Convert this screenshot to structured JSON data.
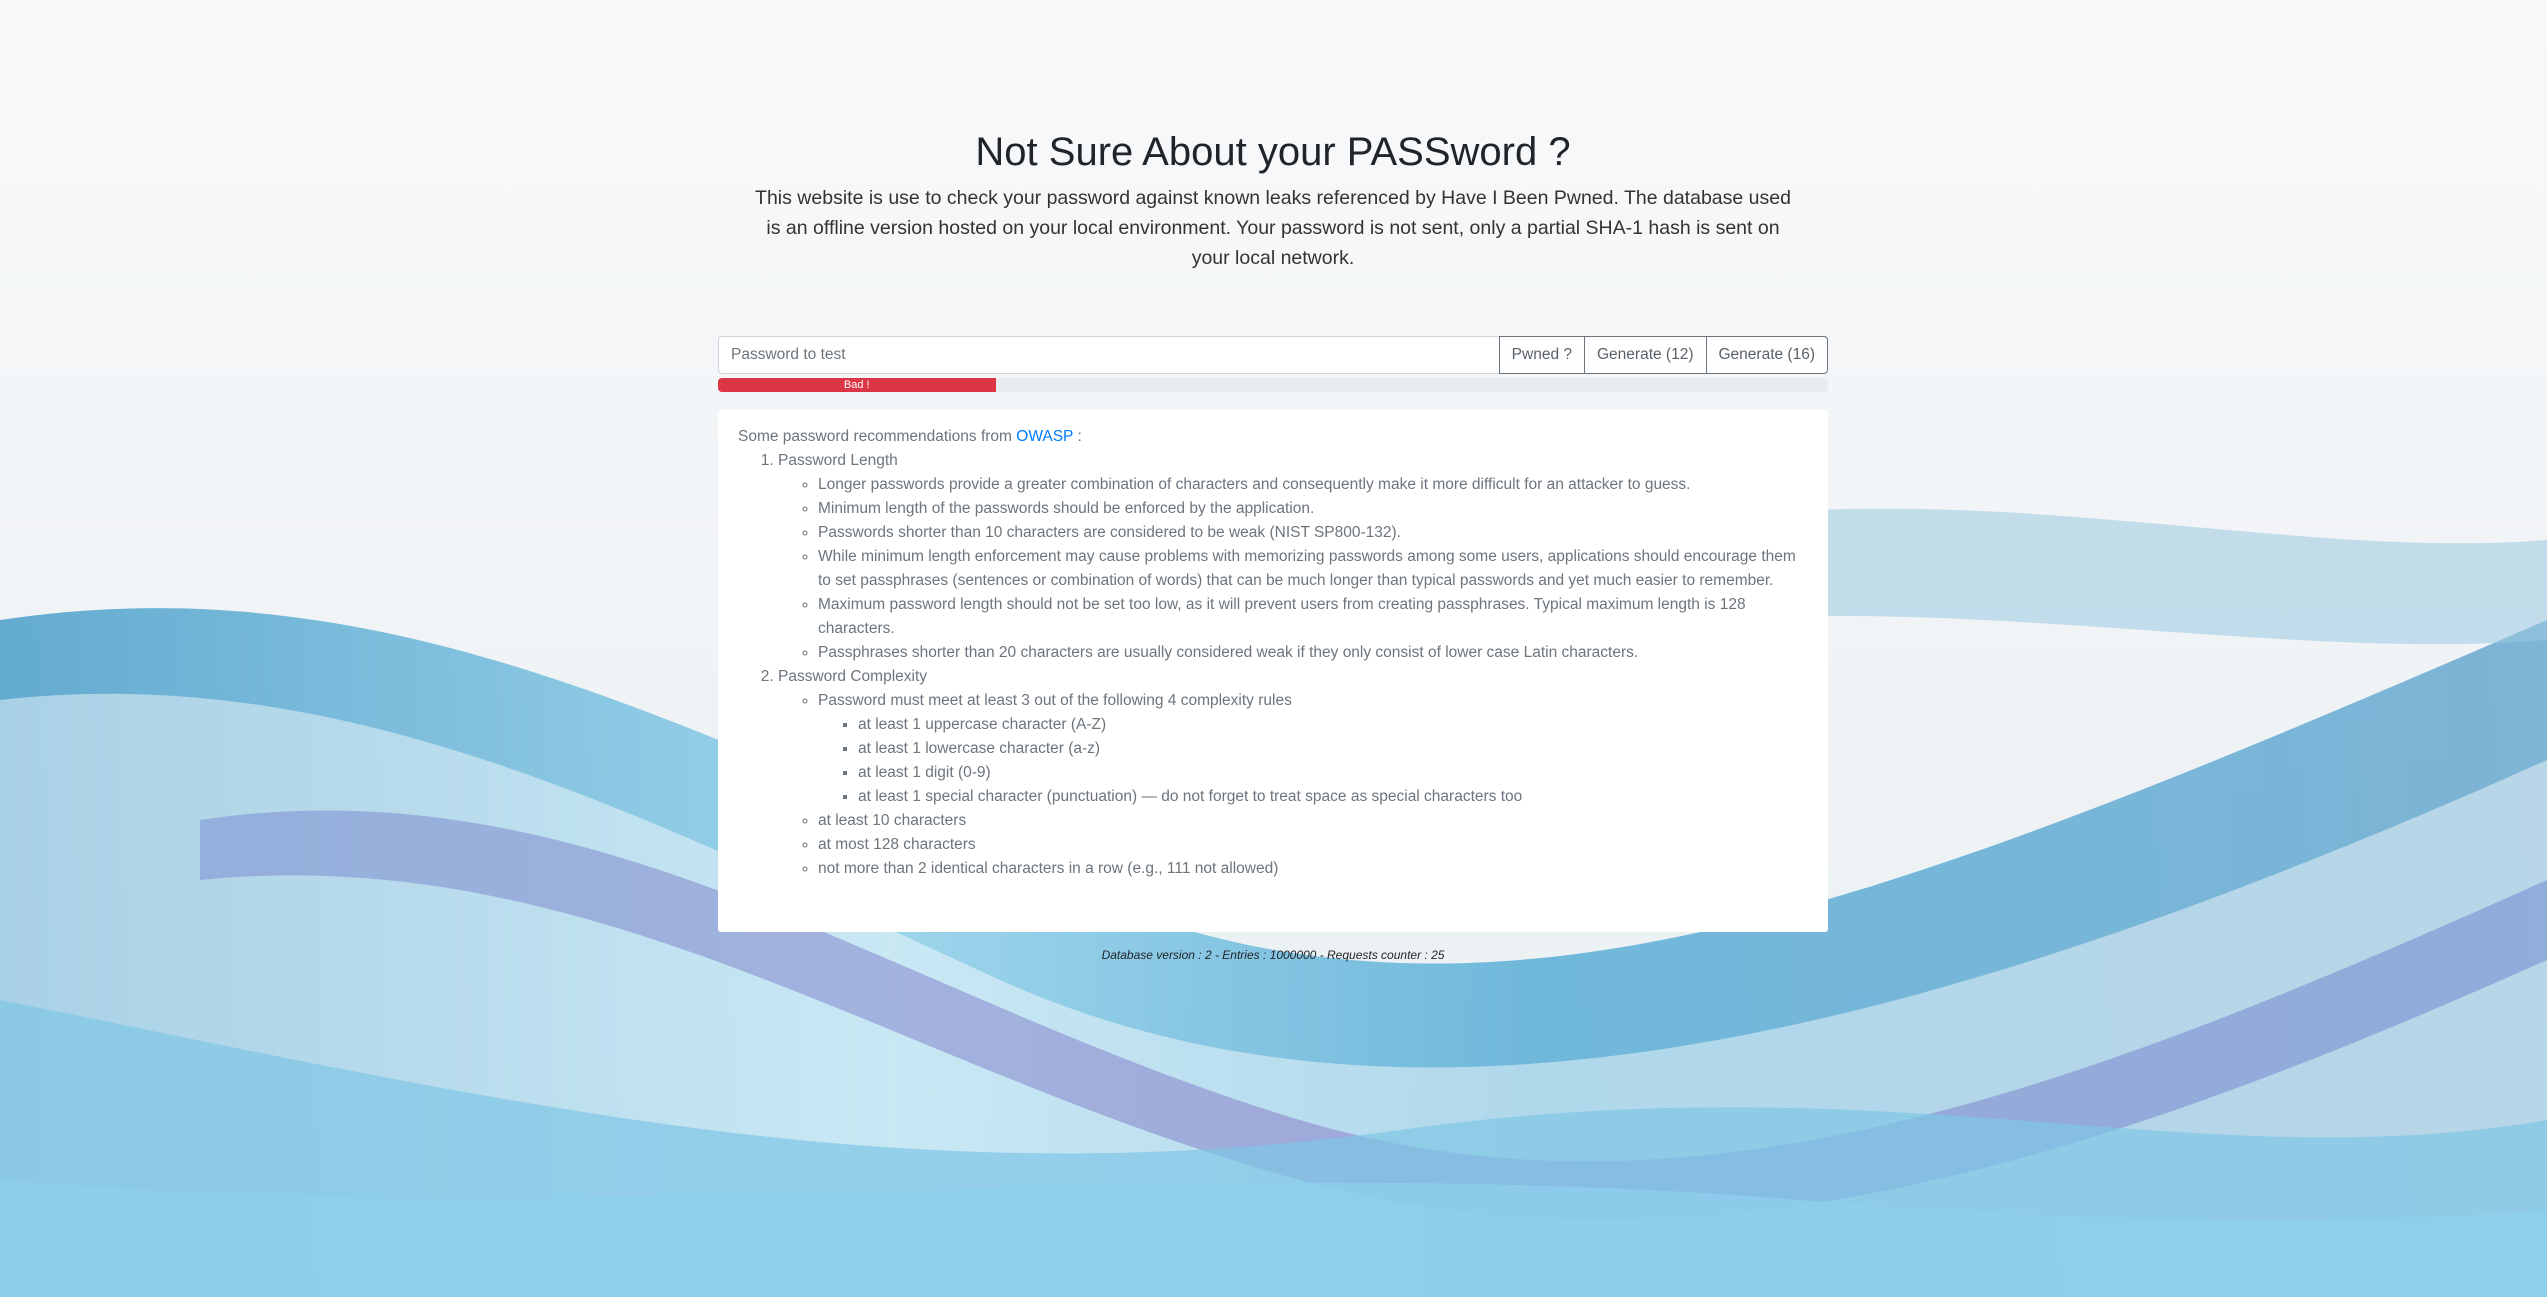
{
  "page": {
    "title": "Not Sure About your PASSword ?",
    "lead": "This website is use to check your password against known leaks referenced by Have I Been Pwned. The database used is an offline version hosted on your local environment. Your password is not sent, only a partial SHA-1 hash is sent on your local network."
  },
  "form": {
    "placeholder": "Password to test",
    "value": "",
    "pwned_label": "Pwned ?",
    "generate12_label": "Generate (12)",
    "generate16_label": "Generate (16)"
  },
  "strength": {
    "label": "Bad !",
    "percent": 25,
    "color": "#dc3545"
  },
  "recommendations": {
    "intro_prefix": "Some password recommendations from",
    "link_text": "OWASP",
    "intro_suffix": ":",
    "sections": [
      {
        "title": "Password Length",
        "items": [
          {
            "text": "Longer passwords provide a greater combination of characters and consequently make it more difficult for an attacker to guess."
          },
          {
            "text": "Minimum length of the passwords should be enforced by the application."
          },
          {
            "text": "Passwords shorter than 10 characters are considered to be weak (NIST SP800-132)."
          },
          {
            "text": "While minimum length enforcement may cause problems with memorizing passwords among some users, applications should encourage them to set passphrases (sentences or combination of words) that can be much longer than typical passwords and yet much easier to remember."
          },
          {
            "text": "Maximum password length should not be set too low, as it will prevent users from creating passphrases. Typical maximum length is 128 characters."
          },
          {
            "text": "Passphrases shorter than 20 characters are usually considered weak if they only consist of lower case Latin characters."
          }
        ]
      },
      {
        "title": "Password Complexity",
        "items": [
          {
            "text": "Password must meet at least 3 out of the following 4 complexity rules",
            "sub": [
              "at least 1 uppercase character (A-Z)",
              "at least 1 lowercase character (a-z)",
              "at least 1 digit (0-9)",
              "at least 1 special character (punctuation) — do not forget to treat space as special characters too"
            ]
          },
          {
            "text": "at least 10 characters"
          },
          {
            "text": "at most 128 characters"
          },
          {
            "text": "not more than 2 identical characters in a row (e.g., 111 not allowed)"
          }
        ]
      }
    ]
  },
  "footer": {
    "text": "Database version : 2 - Entries : 1000000 - Requests counter : 25"
  }
}
